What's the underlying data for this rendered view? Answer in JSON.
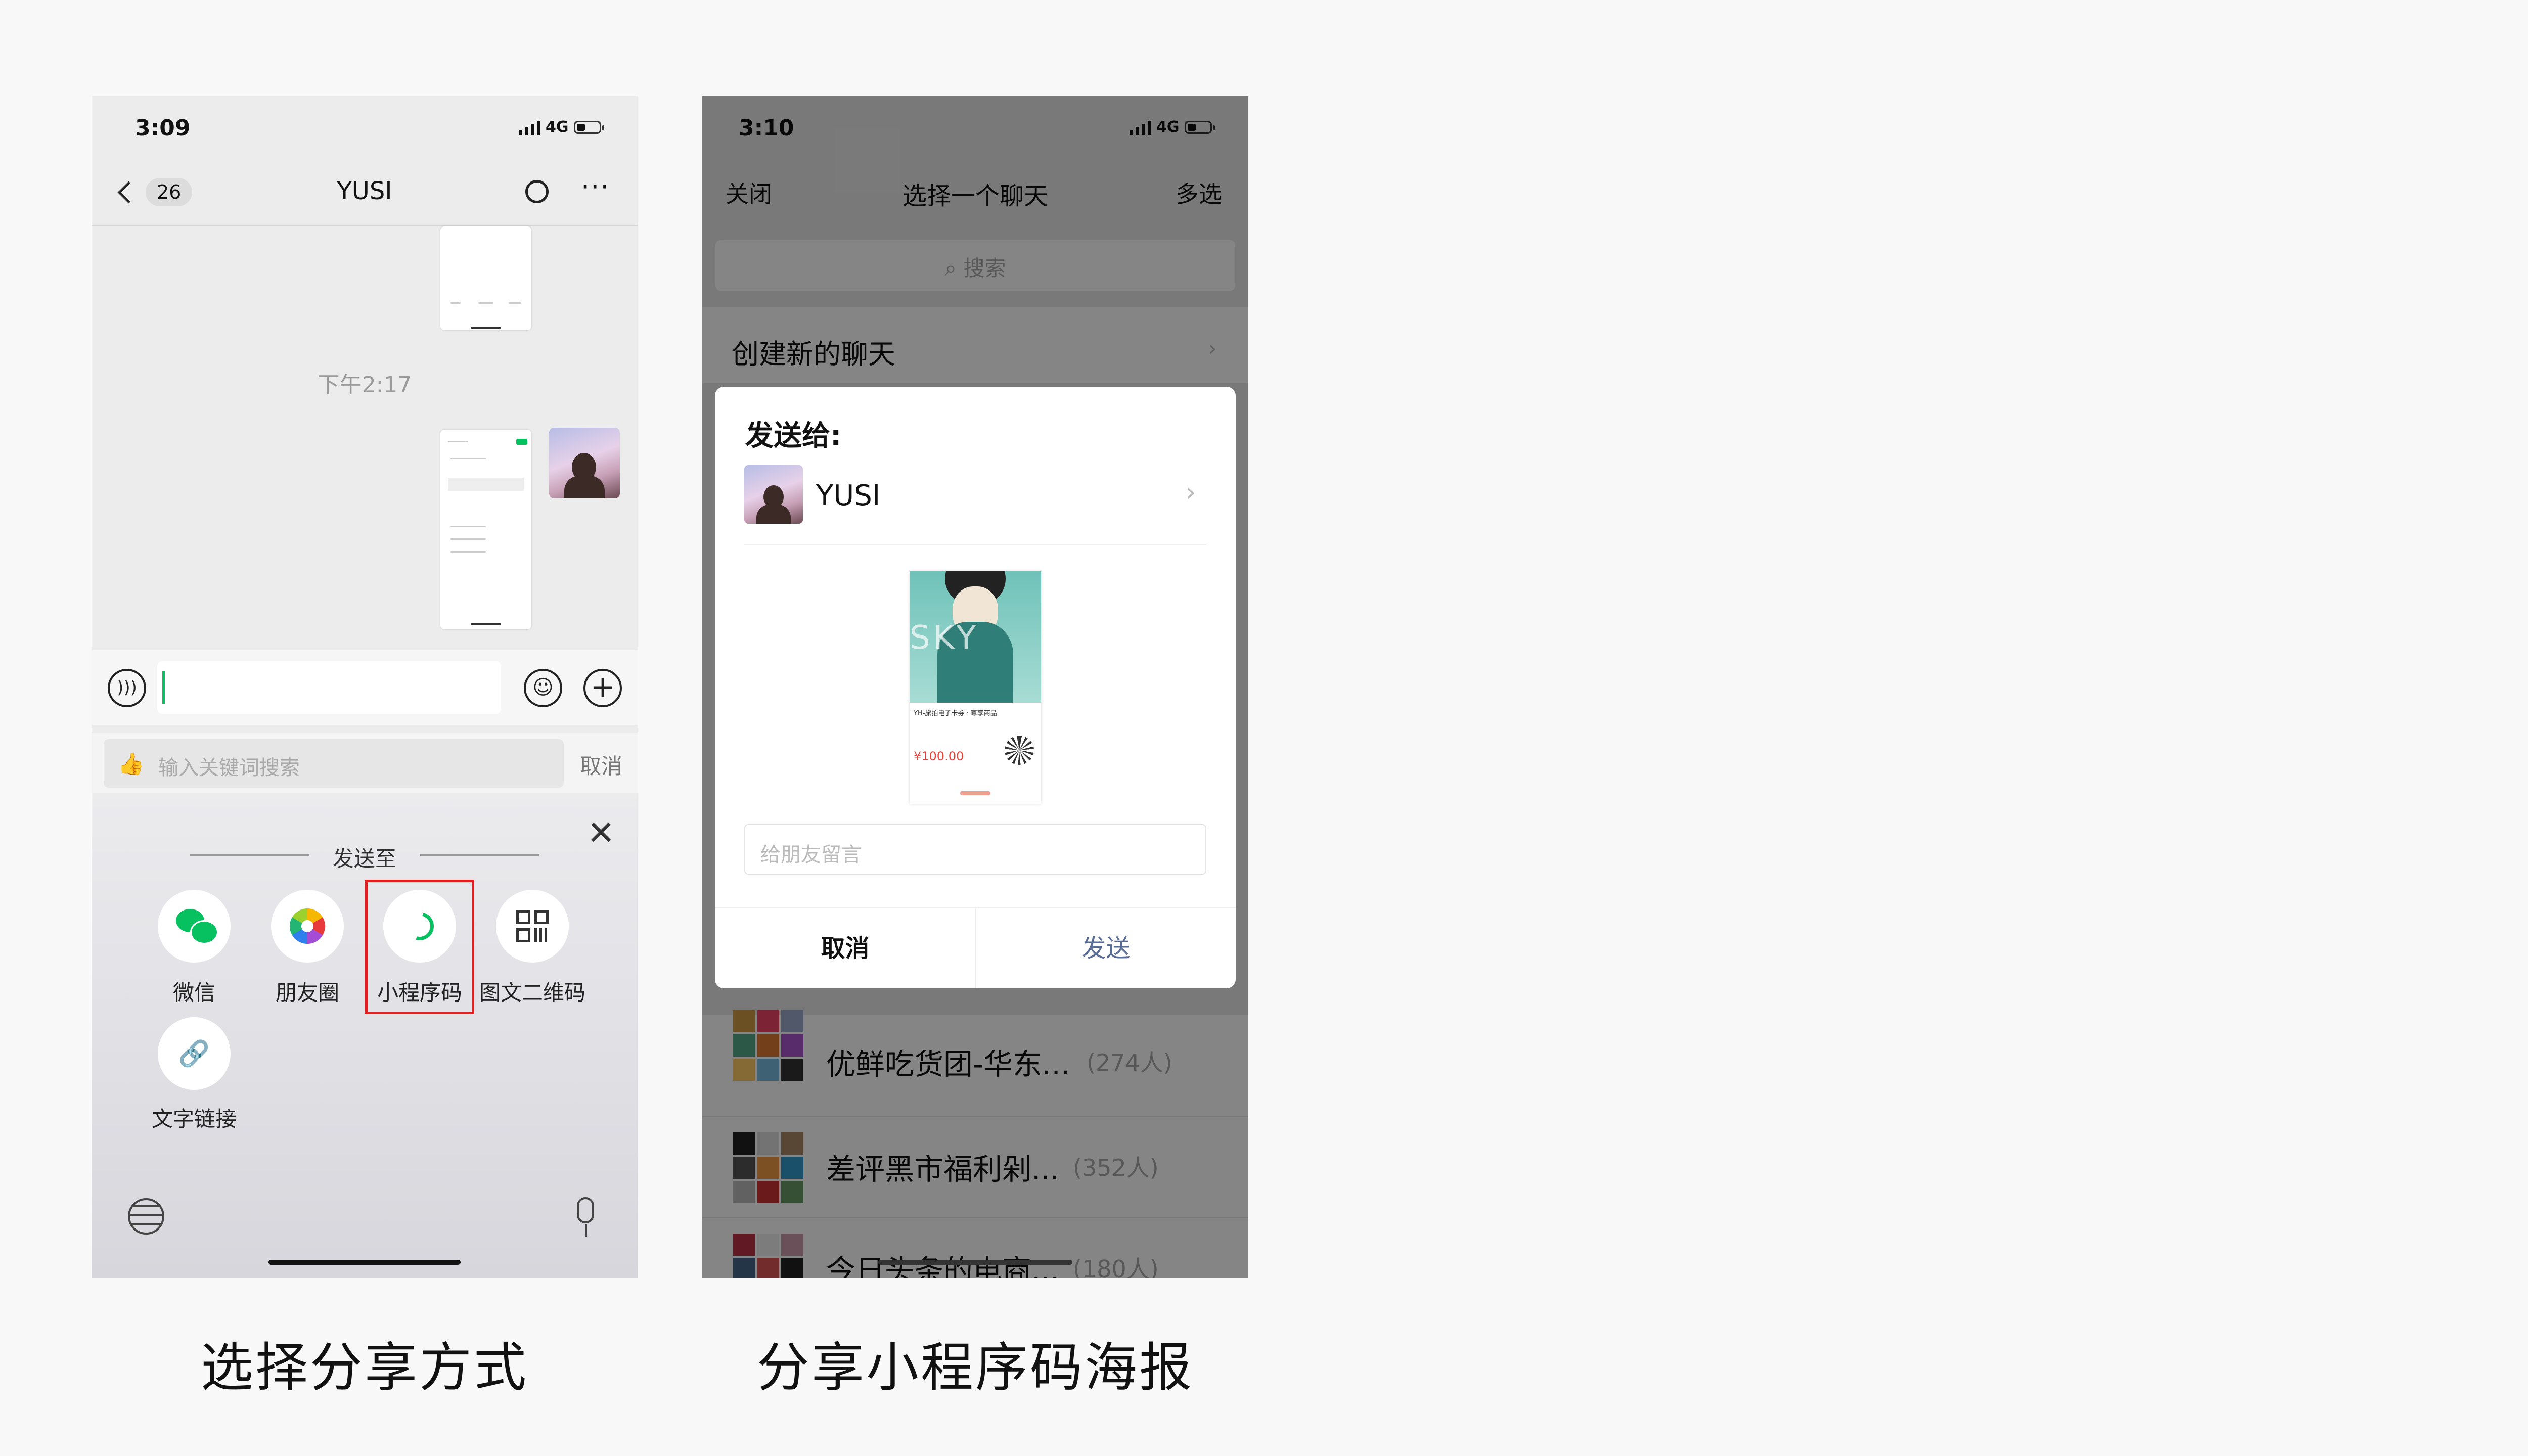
{
  "left": {
    "status": {
      "time": "3:09",
      "network": "4G"
    },
    "nav": {
      "back_count": "26",
      "title": "YUSI"
    },
    "chat": {
      "timestamp": "下午2:17"
    },
    "search": {
      "placeholder": "输入关键词搜索",
      "cancel": "取消"
    },
    "share": {
      "title": "发送至",
      "options": [
        {
          "label": "微信",
          "icon": "wechat-icon"
        },
        {
          "label": "朋友圈",
          "icon": "moments-icon"
        },
        {
          "label": "小程序码",
          "icon": "miniprogram-icon",
          "highlighted": true
        },
        {
          "label": "图文二维码",
          "icon": "qrcode-icon"
        },
        {
          "label": "文字链接",
          "icon": "link-icon"
        }
      ]
    },
    "caption": "选择分享方式"
  },
  "right": {
    "status": {
      "time": "3:10",
      "network": "4G"
    },
    "nav": {
      "close": "关闭",
      "title": "选择一个聊天",
      "multi": "多选"
    },
    "search": {
      "placeholder": "搜索"
    },
    "new_chat": "创建新的聊天",
    "dialog": {
      "send_to": "发送给:",
      "recipient": "YUSI",
      "poster": {
        "watermark": "SKY",
        "title": "YH-旅拍电子卡券 · 尊享商品",
        "price": "¥100.00"
      },
      "message_placeholder": "给朋友留言",
      "cancel": "取消",
      "send": "发送"
    },
    "groups": [
      {
        "name": "优鲜吃货团-华东...",
        "count": "(274人)"
      },
      {
        "name": "差评黑市福利剁...",
        "count": "(352人)"
      },
      {
        "name": "今日头条的电商...",
        "count": "(180人)"
      }
    ],
    "caption": "分享小程序码海报"
  },
  "colors": {
    "wechat_green": "#07c160",
    "highlight_red": "#e02020",
    "price_red": "#e5423a",
    "send_blue": "#576b95"
  }
}
